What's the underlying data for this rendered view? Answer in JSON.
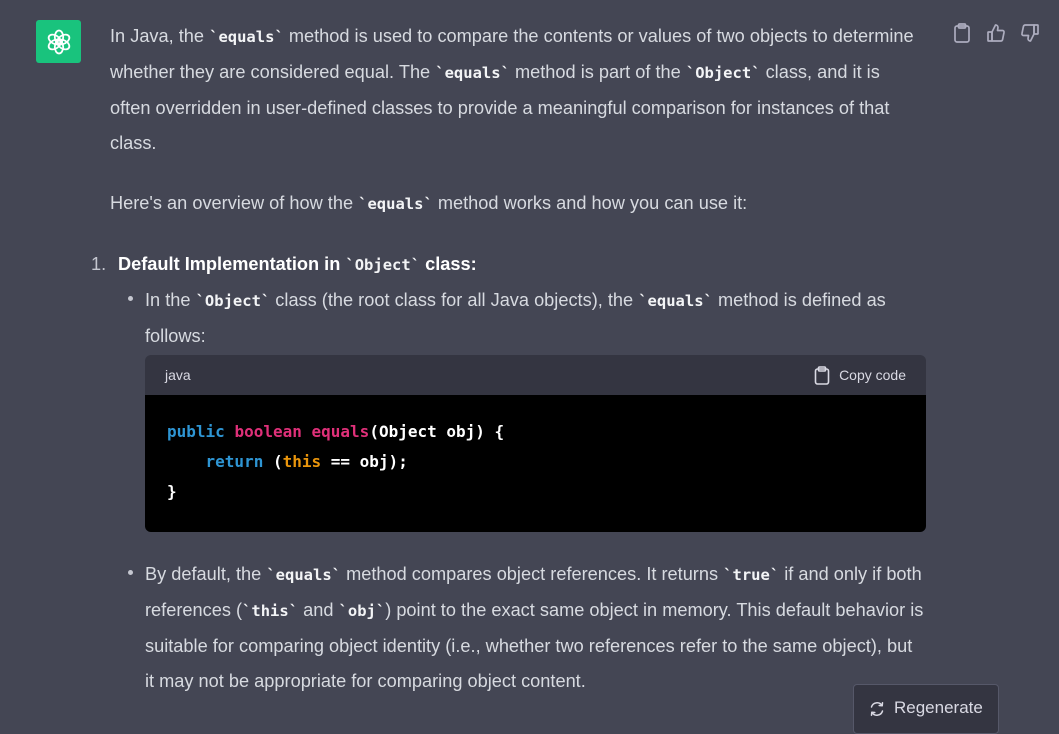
{
  "message": {
    "p1": {
      "a": "In Java, the ",
      "c1": "equals",
      "b": " method is used to compare the contents or values of two objects to determine whether they are considered equal. The ",
      "c2": "equals",
      "c": " method is part of the ",
      "c3": "Object",
      "d": " class, and it is often overridden in user-defined classes to provide a meaningful comparison for instances of that class."
    },
    "p2": {
      "a": "Here's an overview of how the ",
      "c1": "equals",
      "b": " method works and how you can use it:"
    },
    "list": {
      "num": "1.",
      "head_a": "Default Implementation in ",
      "head_c": "Object",
      "head_b": " class:"
    },
    "bullet1": {
      "a": "In the ",
      "c1": "Object",
      "b": " class (the root class for all Java objects), the ",
      "c2": "equals",
      "c": " method is defined as follows:"
    },
    "code": {
      "language": "java",
      "copy_label": "Copy code",
      "l1_kw1": "public",
      "l1_kw2": "boolean",
      "l1_fn": "equals",
      "l1_rest": "(Object obj) {",
      "l2_indent": "    ",
      "l2_kw": "return",
      "l2_open": " (",
      "l2_this": "this",
      "l2_rest": " == obj);",
      "l3": "}"
    },
    "bullet2": {
      "a": "By default, the ",
      "c1": "equals",
      "b": " method compares object references. It returns ",
      "c2": "true",
      "c": " if and only if both references (",
      "c3": "this",
      "d": " and ",
      "c4": "obj",
      "e": ") point to the exact same object in memory. This default behavior is suitable for comparing object identity (i.e., whether two references refer to the same object), but it may not be appropriate for comparing object content."
    }
  },
  "regenerate_label": "Regenerate",
  "colors": {
    "background": "#444654",
    "avatar": "#19c37d",
    "code_bg": "#000000",
    "keyword_blue": "#2e95d3",
    "keyword_red": "#df3079",
    "keyword_orange": "#e9950c"
  },
  "icons": [
    "openai-logo-icon",
    "clipboard-icon",
    "thumbs-up-icon",
    "thumbs-down-icon",
    "refresh-icon"
  ]
}
